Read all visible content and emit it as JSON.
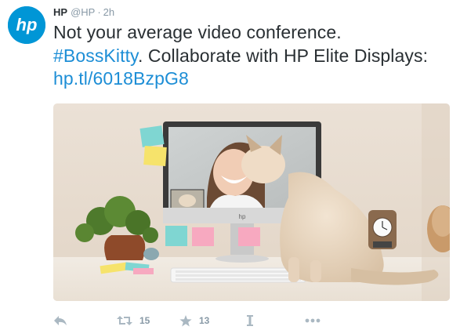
{
  "tweet": {
    "author_name": "HP",
    "author_handle": "@HP",
    "separator": "·",
    "time": "2h",
    "avatar_logo_text": "hp",
    "text_line1": "Not your average video conference.",
    "hashtag": "#BossKitty",
    "text_after_hashtag": ". Collaborate with HP Elite Displays: ",
    "link": "hp.tl/6018BzpG8"
  },
  "media": {
    "description_icon": "photo",
    "monitor_brand": "hp"
  },
  "actions": {
    "reply_icon": "reply-icon",
    "retweet_icon": "retweet-icon",
    "retweet_count": "15",
    "favorite_icon": "star-icon",
    "favorite_count": "13",
    "share_icon": "share-icon",
    "more_icon": "more-icon"
  },
  "colors": {
    "brand": "#0096d6",
    "link": "#1d8ed6",
    "text": "#292f33",
    "muted": "#8899a6",
    "action": "#aab8c2"
  }
}
